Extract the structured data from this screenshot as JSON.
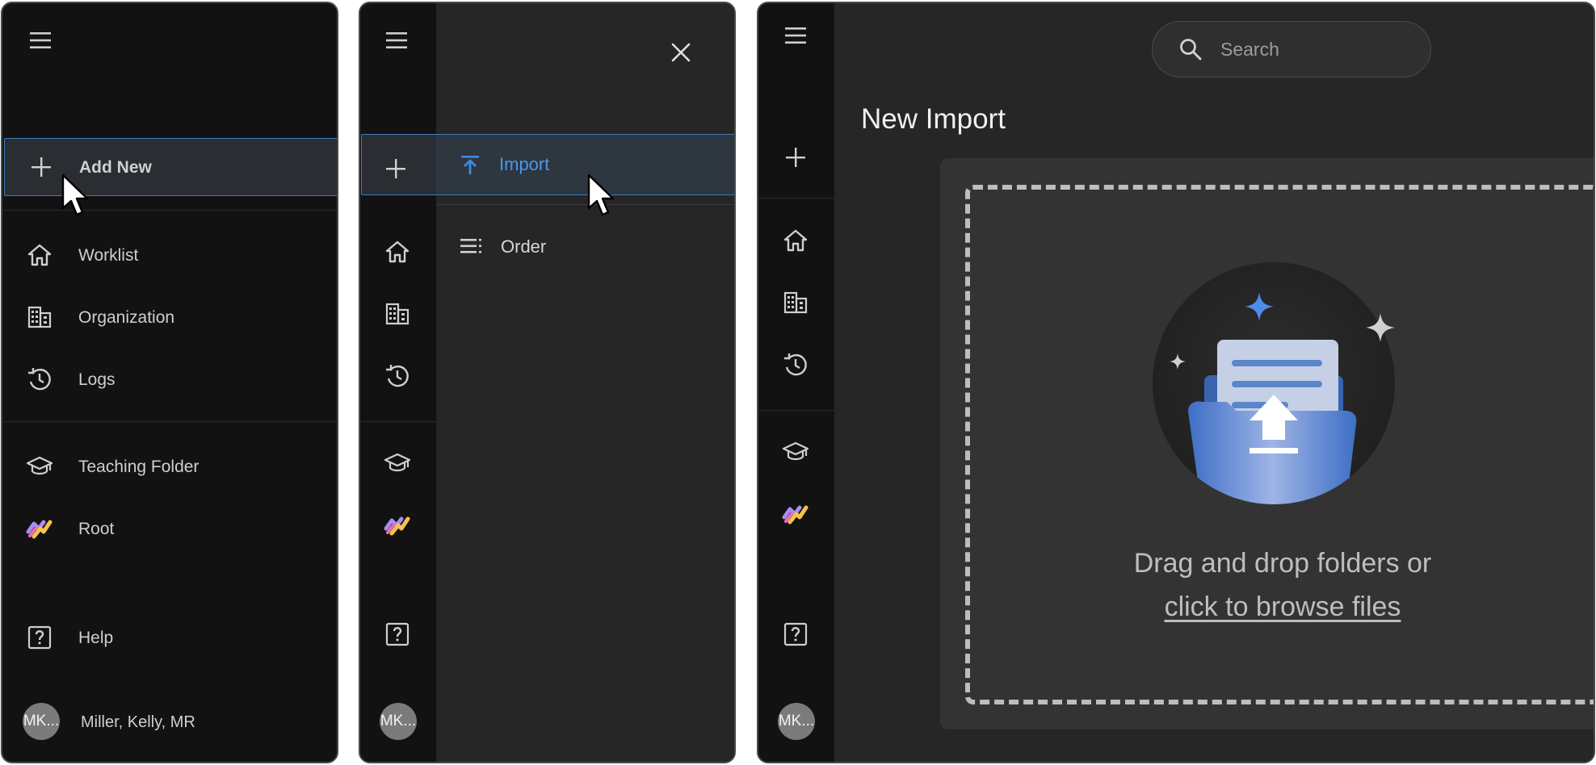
{
  "expanded_nav": {
    "add_new": "Add New",
    "items": [
      {
        "label": "Worklist",
        "icon": "home-icon"
      },
      {
        "label": "Organization",
        "icon": "building-icon"
      },
      {
        "label": "Logs",
        "icon": "history-icon"
      }
    ],
    "items2": [
      {
        "label": "Teaching Folder",
        "icon": "graduation-cap-icon"
      },
      {
        "label": "Root",
        "icon": "root-logo-icon"
      }
    ],
    "help": "Help",
    "user": {
      "initials": "MK...",
      "name": "Miller, Kelly, MR"
    }
  },
  "add_menu": {
    "items": [
      {
        "label": "Import",
        "icon": "upload-icon",
        "active": true
      },
      {
        "label": "Order",
        "icon": "list-icon",
        "active": false
      }
    ],
    "user_initials": "MK..."
  },
  "import_page": {
    "search_placeholder": "Search",
    "title": "New Import",
    "drop_text": "Drag and drop folders or",
    "browse_link": "click to browse files",
    "user_initials": "MK..."
  },
  "colors": {
    "accent": "#3d8ae0",
    "highlight_border": "#3d7cc0",
    "panel_bg": "#121212",
    "surface_bg": "#262626",
    "notification_dot": "#4ea3f0"
  }
}
